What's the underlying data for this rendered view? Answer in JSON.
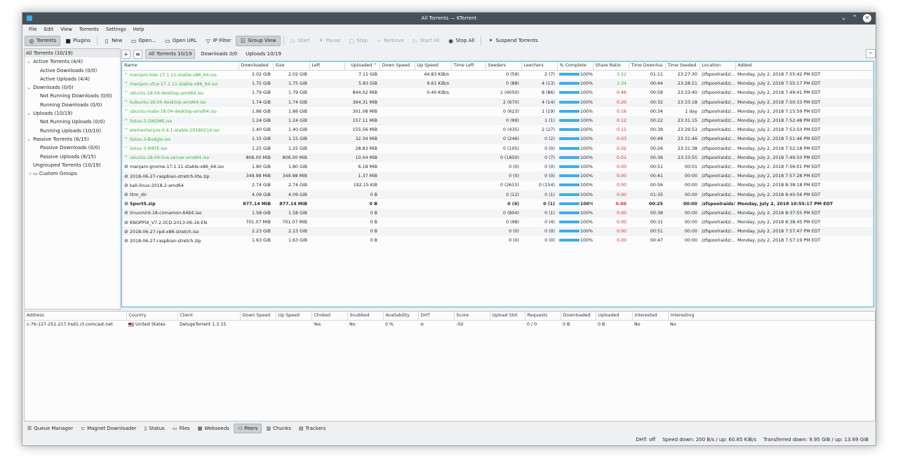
{
  "window": {
    "title": "All Torrents — KTorrent"
  },
  "menu": [
    "File",
    "Edit",
    "View",
    "Torrents",
    "Settings",
    "Help"
  ],
  "toolbar": {
    "torrents": "Torrents",
    "plugins": "Plugins",
    "new": "New",
    "open": "Open...",
    "open_url": "Open URL",
    "ip_filter": "IP Filter",
    "group_view": "Group View",
    "start": "Start",
    "pause": "Pause",
    "stop": "Stop",
    "remove": "Remove",
    "start_all": "Start All",
    "stop_all": "Stop All",
    "suspend": "Suspend Torrents"
  },
  "groups": [
    "All Torrents (10/19)",
    "Active Torrents (4/4)",
    "Active Downloads (0/0)",
    "Active Uploads (4/4)",
    "Downloads (0/0)",
    "Not Running Downloads (0/0)",
    "Running Downloads (0/0)",
    "Uploads (10/19)",
    "Not Running Uploads (0/0)",
    "Running Uploads (10/10)",
    "Passive Torrents (6/15)",
    "Passive Downloads (0/0)",
    "Passive Uploads (6/15)",
    "Ungrouped Torrents (10/19)",
    "Custom Groups"
  ],
  "tabs": {
    "all": "All Torrents 10/19",
    "downloads": "Downloads 0/0",
    "uploads": "Uploads 10/19"
  },
  "columns": [
    "Name",
    "Downloaded",
    "Size",
    "Left",
    "Uploaded",
    "Down Speed",
    "Up Speed",
    "Time Left",
    "Seeders",
    "Leechers",
    "% Complete",
    "Share Ratio",
    "Time Downloa",
    "Time Seeded",
    "Location",
    "Added"
  ],
  "torrents": [
    {
      "name": "manjaro-kde-17.1.11-stable-x86_64.iso",
      "downloaded": "2.02 GiB",
      "size": "2.02 GiB",
      "left": "",
      "uploaded": "7.11 GiB",
      "down_speed": "",
      "up_speed": "44.83 KiB/s",
      "time_left": "",
      "seeders": "0 (59)",
      "leechers": "2 (7)",
      "complete": "100%",
      "ratio": "3.52",
      "ratio_color": "green",
      "time_dl": "01:11",
      "time_seeded": "23:27:30",
      "location": "/zfspoolraidz/...",
      "added": "Monday, July 2, 2018 7:55:42 PM EDT",
      "active": true
    },
    {
      "name": "manjaro-xfce-17.1.11-stable-x86_64.iso",
      "downloaded": "1.75 GiB",
      "size": "1.75 GiB",
      "left": "",
      "uploaded": "5.83 GiB",
      "down_speed": "",
      "up_speed": "9.61 KiB/s",
      "time_left": "",
      "seeders": "0 (88)",
      "leechers": "4 (13)",
      "complete": "100%",
      "ratio": "3.34",
      "ratio_color": "green",
      "time_dl": "00:44",
      "time_seeded": "23:28:21",
      "location": "/zfspoolraidz/...",
      "added": "Monday, July 2, 2018 7:55:17 PM EDT",
      "active": true
    },
    {
      "name": "ubuntu-18.04-desktop-amd64.iso",
      "downloaded": "1.79 GiB",
      "size": "1.79 GiB",
      "left": "",
      "uploaded": "844.02 MiB",
      "down_speed": "",
      "up_speed": "0.40 KiB/s",
      "time_left": "",
      "seeders": "1 (4050)",
      "leechers": "8 (86)",
      "complete": "100%",
      "ratio": "0.46",
      "ratio_color": "red",
      "time_dl": "00:58",
      "time_seeded": "23:33:40",
      "location": "/zfspoolraidz/...",
      "added": "Monday, July 2, 2018 7:49:41 PM EDT",
      "active": true
    },
    {
      "name": "kubuntu-18.04-desktop-amd64.iso",
      "downloaded": "1.74 GiB",
      "size": "1.74 GiB",
      "left": "",
      "uploaded": "364.31 MiB",
      "down_speed": "",
      "up_speed": "",
      "time_left": "",
      "seeders": "2 (670)",
      "leechers": "4 (14)",
      "complete": "100%",
      "ratio": "0.20",
      "ratio_color": "red",
      "time_dl": "00:32",
      "time_seeded": "23:33:18",
      "location": "/zfspoolraidz/...",
      "added": "Monday, July 2, 2018 7:50:33 PM EDT",
      "active": true
    },
    {
      "name": "ubuntu-mate-18.04-desktop-amd64.iso",
      "downloaded": "1.86 GiB",
      "size": "1.86 GiB",
      "left": "",
      "uploaded": "301.08 MiB",
      "down_speed": "",
      "up_speed": "",
      "time_left": "",
      "seeders": "0 (623)",
      "leechers": "1 (19)",
      "complete": "100%",
      "ratio": "0.16",
      "ratio_color": "red",
      "time_dl": "00:34",
      "time_seeded": "1 day",
      "location": "/zfspoolraidz/...",
      "added": "Monday, July 2, 2018 7:15:59 PM EDT",
      "active": true
    },
    {
      "name": "Solus-3-GNOME.iso",
      "downloaded": "1.24 GiB",
      "size": "1.24 GiB",
      "left": "",
      "uploaded": "157.11 MiB",
      "down_speed": "",
      "up_speed": "",
      "time_left": "",
      "seeders": "0 (99)",
      "leechers": "1 (1)",
      "complete": "100%",
      "ratio": "0.12",
      "ratio_color": "red",
      "time_dl": "00:22",
      "time_seeded": "23:31:15",
      "location": "/zfspoolraidz/...",
      "added": "Monday, July 2, 2018 7:52:48 PM EDT",
      "active": true
    },
    {
      "name": "elementaryos-0.4.1-stable.20180214.iso",
      "downloaded": "1.40 GiB",
      "size": "1.40 GiB",
      "left": "",
      "uploaded": "155.56 MiB",
      "down_speed": "",
      "up_speed": "",
      "time_left": "",
      "seeders": "0 (435)",
      "leechers": "2 (27)",
      "complete": "100%",
      "ratio": "0.11",
      "ratio_color": "red",
      "time_dl": "00:39",
      "time_seeded": "23:29:53",
      "location": "/zfspoolraidz/...",
      "added": "Monday, July 2, 2018 7:53:50 PM EDT",
      "active": true
    },
    {
      "name": "Solus-3-Budgie.iso",
      "downloaded": "1.15 GiB",
      "size": "1.15 GiB",
      "left": "",
      "uploaded": "32.34 MiB",
      "down_speed": "",
      "up_speed": "",
      "time_left": "",
      "seeders": "0 (246)",
      "leechers": "0 (2)",
      "complete": "100%",
      "ratio": "0.03",
      "ratio_color": "red",
      "time_dl": "00:48",
      "time_seeded": "23:31:46",
      "location": "/zfspoolraidz/...",
      "added": "Monday, July 2, 2018 7:51:46 PM EDT",
      "active": true
    },
    {
      "name": "Solus-3-MATE.iso",
      "downloaded": "1.25 GiB",
      "size": "1.25 GiB",
      "left": "",
      "uploaded": "28.83 MiB",
      "down_speed": "",
      "up_speed": "",
      "time_left": "",
      "seeders": "0 (105)",
      "leechers": "0 (0)",
      "complete": "100%",
      "ratio": "0.02",
      "ratio_color": "red",
      "time_dl": "00:26",
      "time_seeded": "23:31:38",
      "location": "/zfspoolraidz/...",
      "added": "Monday, July 2, 2018 7:52:18 PM EDT",
      "active": true
    },
    {
      "name": "ubuntu-18.04-live-server-amd64.iso",
      "downloaded": "806.00 MiB",
      "size": "806.00 MiB",
      "left": "",
      "uploaded": "10.04 MiB",
      "down_speed": "",
      "up_speed": "",
      "time_left": "",
      "seeders": "0 (1850)",
      "leechers": "0 (7)",
      "complete": "100%",
      "ratio": "0.01",
      "ratio_color": "red",
      "time_dl": "00:36",
      "time_seeded": "23:33:55",
      "location": "/zfspoolraidz/...",
      "added": "Monday, July 2, 2018 7:49:50 PM EDT",
      "active": true
    },
    {
      "name": "manjaro-gnome-17.1.11-stable-x86_64.iso",
      "downloaded": "1.80 GiB",
      "size": "1.80 GiB",
      "left": "",
      "uploaded": "6.18 MiB",
      "down_speed": "",
      "up_speed": "",
      "time_left": "",
      "seeders": "0 (0)",
      "leechers": "0 (0)",
      "complete": "100%",
      "ratio": "0.00",
      "ratio_color": "red",
      "time_dl": "00:51",
      "time_seeded": "00:01",
      "location": "/zfspoolraidz/...",
      "added": "Monday, July 2, 2018 7:56:01 PM EDT",
      "active": false
    },
    {
      "name": "2018-06-27-raspbian-stretch-lite.zip",
      "downloaded": "349.98 MiB",
      "size": "349.98 MiB",
      "left": "",
      "uploaded": "1.37 MiB",
      "down_speed": "",
      "up_speed": "",
      "time_left": "",
      "seeders": "0 (0)",
      "leechers": "0 (0)",
      "complete": "100%",
      "ratio": "0.00",
      "ratio_color": "red",
      "time_dl": "00:41",
      "time_seeded": "00:00",
      "location": "/zfspoolraidz/...",
      "added": "Monday, July 2, 2018 7:57:28 PM EDT",
      "active": false
    },
    {
      "name": "kali-linux-2018.2-amd64",
      "downloaded": "2.74 GiB",
      "size": "2.74 GiB",
      "left": "",
      "uploaded": "192.15 KiB",
      "down_speed": "",
      "up_speed": "",
      "time_left": "",
      "seeders": "0 (2615)",
      "leechers": "0 (154)",
      "complete": "100%",
      "ratio": "0.00",
      "ratio_color": "red",
      "time_dl": "00:56",
      "time_seeded": "00:00",
      "location": "/zfspoolraidz/...",
      "added": "Monday, July 2, 2018 8:38:18 PM EDT",
      "active": false
    },
    {
      "name": "thm_dir",
      "downloaded": "4.09 GiB",
      "size": "4.09 GiB",
      "left": "",
      "uploaded": "0 B",
      "down_speed": "",
      "up_speed": "",
      "time_left": "",
      "seeders": "0 (12)",
      "leechers": "0 (1)",
      "complete": "100%",
      "ratio": "0.00",
      "ratio_color": "red",
      "time_dl": "01:35",
      "time_seeded": "00:00",
      "location": "/zfspoolraidz/...",
      "added": "Monday, July 2, 2018 8:40:56 PM EDT",
      "active": false
    },
    {
      "name": "Sport5.zip",
      "downloaded": "877.14 MiB",
      "size": "877.14 MiB",
      "left": "",
      "uploaded": "0 B",
      "down_speed": "",
      "up_speed": "",
      "time_left": "",
      "seeders": "0 (4)",
      "leechers": "0 (1)",
      "complete": "100%",
      "ratio": "0.00",
      "ratio_color": "red",
      "time_dl": "00:25",
      "time_seeded": "00:00",
      "location": "/zfspoolraidz/...",
      "added": "Monday, July 2, 2018 10:55:17 PM EDT",
      "active": false,
      "bold": true
    },
    {
      "name": "linuxmint-18-cinnamon-64bit.iso",
      "downloaded": "1.58 GiB",
      "size": "1.58 GiB",
      "left": "",
      "uploaded": "0 B",
      "down_speed": "",
      "up_speed": "",
      "time_left": "",
      "seeders": "0 (804)",
      "leechers": "0 (1)",
      "complete": "100%",
      "ratio": "0.00",
      "ratio_color": "red",
      "time_dl": "00:38",
      "time_seeded": "00:00",
      "location": "/zfspoolraidz/...",
      "added": "Monday, July 2, 2018 8:37:55 PM EDT",
      "active": false
    },
    {
      "name": "KNOPPIX_V7.2.0CD-2013-06-16-EN",
      "downloaded": "701.07 MiB",
      "size": "701.07 MiB",
      "left": "",
      "uploaded": "0 B",
      "down_speed": "",
      "up_speed": "",
      "time_left": "",
      "seeders": "0 (98)",
      "leechers": "0 (4)",
      "complete": "100%",
      "ratio": "0.00",
      "ratio_color": "red",
      "time_dl": "00:31",
      "time_seeded": "00:00",
      "location": "/zfspoolraidz/...",
      "added": "Monday, July 2, 2018 8:38:45 PM EDT",
      "active": false
    },
    {
      "name": "2018-06-27-rpd-x86-stretch.iso",
      "downloaded": "2.23 GiB",
      "size": "2.23 GiB",
      "left": "",
      "uploaded": "0 B",
      "down_speed": "",
      "up_speed": "",
      "time_left": "",
      "seeders": "0 (0)",
      "leechers": "0 (0)",
      "complete": "100%",
      "ratio": "0.00",
      "ratio_color": "red",
      "time_dl": "00:51",
      "time_seeded": "00:00",
      "location": "/zfspoolraidz/...",
      "added": "Monday, July 2, 2018 7:57:47 PM EDT",
      "active": false
    },
    {
      "name": "2018-06-27-raspbian-stretch.zip",
      "downloaded": "1.63 GiB",
      "size": "1.63 GiB",
      "left": "",
      "uploaded": "0 B",
      "down_speed": "",
      "up_speed": "",
      "time_left": "",
      "seeders": "0 (0)",
      "leechers": "0 (0)",
      "complete": "100%",
      "ratio": "0.00",
      "ratio_color": "red",
      "time_dl": "00:47",
      "time_seeded": "00:00",
      "location": "/zfspoolraidz/...",
      "added": "Monday, July 2, 2018 7:57:19 PM EDT",
      "active": false
    }
  ],
  "peer_columns": [
    "Address",
    "Country",
    "Client",
    "Down Speed",
    "Up Speed",
    "Choked",
    "Snubbed",
    "Availability",
    "DHT",
    "Score",
    "Upload Slot",
    "Requests",
    "Downloaded",
    "Uploaded",
    "Interested",
    "Interesting"
  ],
  "peers": [
    {
      "address": "c-76-127-251-217.hsd1.ct.comcast.net",
      "country": "United States",
      "client": "DelugeTorrent 1.3.15",
      "down_speed": "",
      "up_speed": "",
      "choked": "Yes",
      "snubbed": "No",
      "availability": "0 %",
      "dht": "⊘",
      "score": "-50",
      "upload_slot": "",
      "requests": "0 / 0",
      "downloaded": "0 B",
      "uploaded": "0 B",
      "interested": "No",
      "interesting": "No"
    }
  ],
  "bottom_tabs": [
    "Queue Manager",
    "Magnet Downloader",
    "Status",
    "Files",
    "Webseeds",
    "Peers",
    "Chunks",
    "Trackers"
  ],
  "status": {
    "dht": "DHT: off",
    "speed": "Speed down: 200 B/s / up: 60.85 KiB/s",
    "transferred": "Transferred down: 9.95 GiB / up: 13.69 GiB"
  },
  "colors": {
    "accent": "#3daee9",
    "active_text": "#34b534",
    "ratio_low": "#e02828",
    "titlebar": "#475057"
  }
}
